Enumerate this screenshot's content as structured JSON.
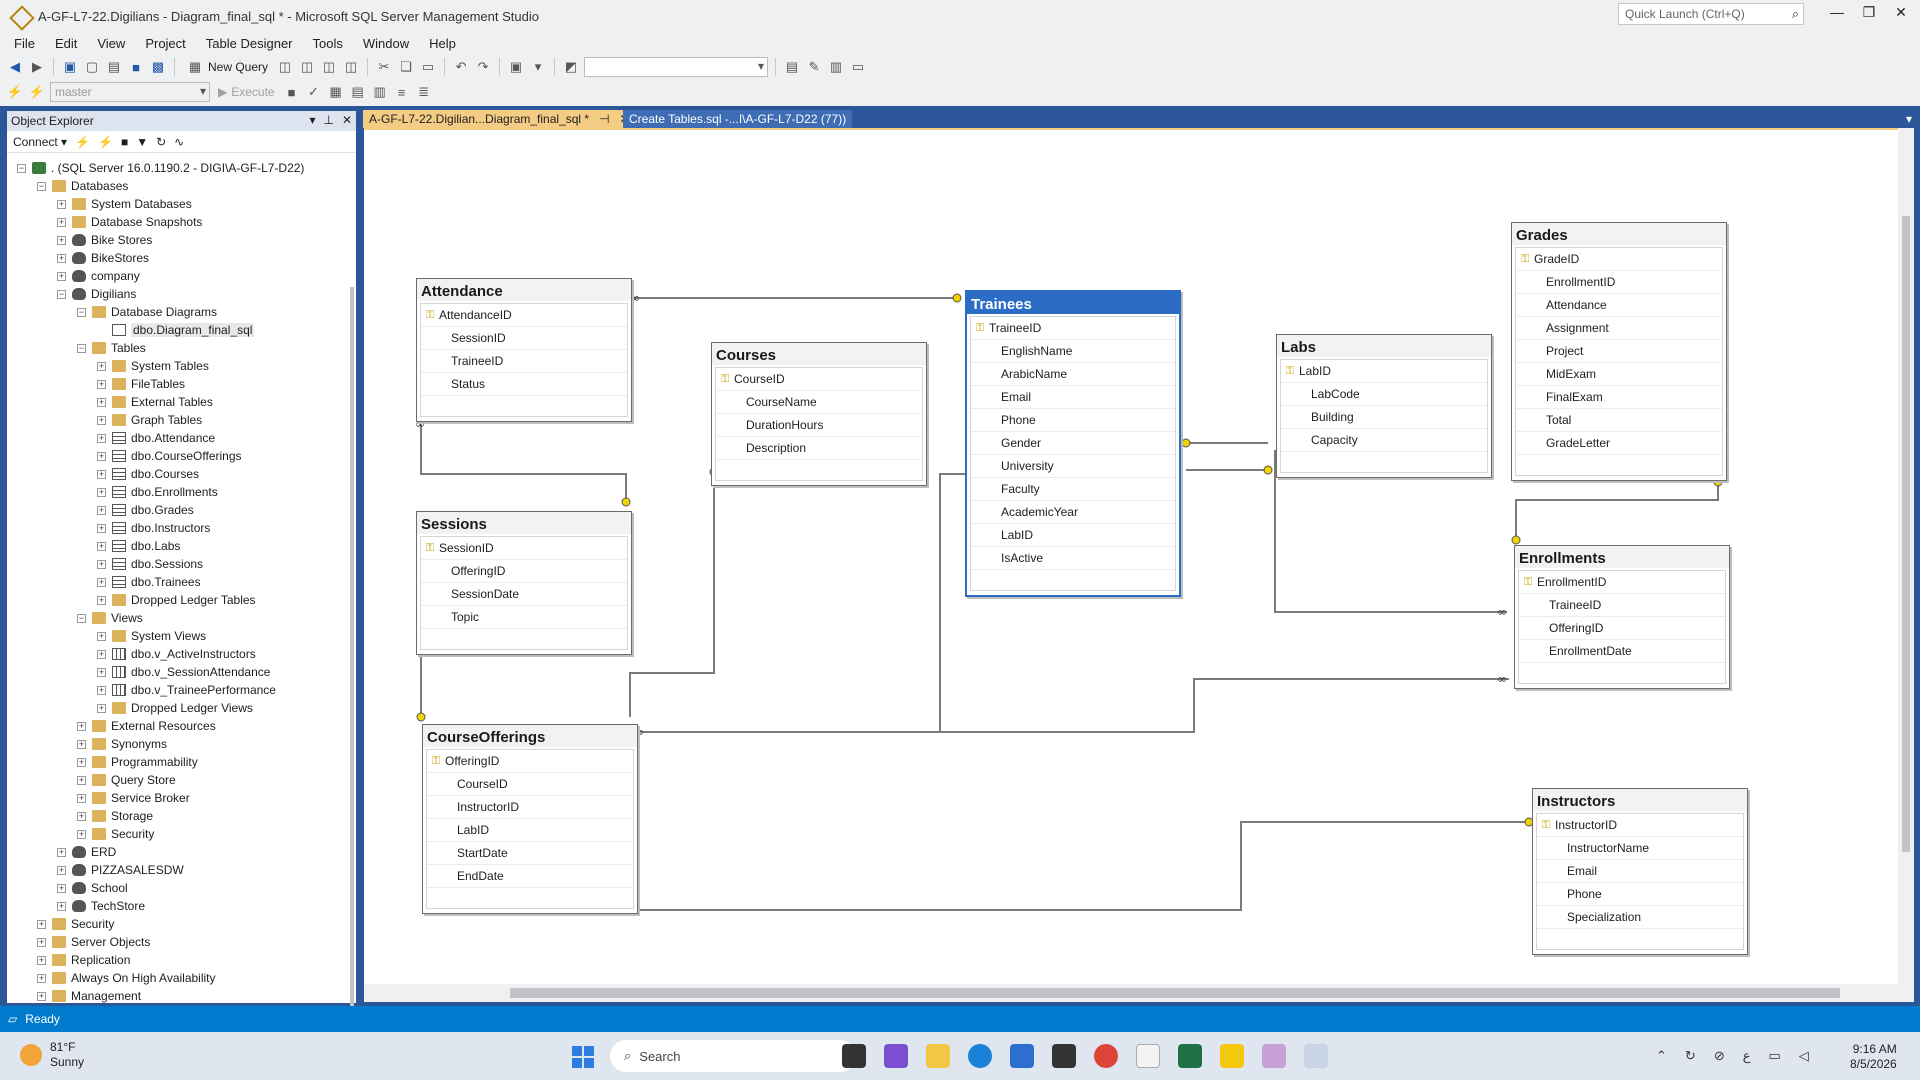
{
  "window": {
    "title": "A-GF-L7-22.Digilians - Diagram_final_sql * - Microsoft SQL Server Management Studio",
    "quick_launch_placeholder": "Quick Launch (Ctrl+Q)"
  },
  "menu": [
    "File",
    "Edit",
    "View",
    "Project",
    "Table Designer",
    "Tools",
    "Window",
    "Help"
  ],
  "toolbar": {
    "new_query": "New Query",
    "database": "master",
    "execute": "Execute"
  },
  "object_explorer": {
    "title": "Object Explorer",
    "connect": "Connect",
    "tree": [
      {
        "label": ". (SQL Server 16.0.1190.2 - DIGI\\A-GF-L7-D22)",
        "level": 0,
        "exp": "−",
        "icon": "server-icon"
      },
      {
        "label": "Databases",
        "level": 1,
        "exp": "−",
        "icon": "folder-icon"
      },
      {
        "label": "System Databases",
        "level": 2,
        "exp": "+",
        "icon": "folder-icon"
      },
      {
        "label": "Database Snapshots",
        "level": 2,
        "exp": "+",
        "icon": "folder-icon"
      },
      {
        "label": "Bike Stores",
        "level": 2,
        "exp": "+",
        "icon": "database-icon"
      },
      {
        "label": "BikeStores",
        "level": 2,
        "exp": "+",
        "icon": "database-icon"
      },
      {
        "label": "company",
        "level": 2,
        "exp": "+",
        "icon": "database-icon"
      },
      {
        "label": "Digilians",
        "level": 2,
        "exp": "−",
        "icon": "database-icon"
      },
      {
        "label": "Database Diagrams",
        "level": 3,
        "exp": "−",
        "icon": "folder-icon"
      },
      {
        "label": "dbo.Diagram_final_sql",
        "level": 4,
        "exp": "",
        "icon": "diagram-icon",
        "selected": true
      },
      {
        "label": "Tables",
        "level": 3,
        "exp": "−",
        "icon": "folder-icon"
      },
      {
        "label": "System Tables",
        "level": 4,
        "exp": "+",
        "icon": "folder-icon"
      },
      {
        "label": "FileTables",
        "level": 4,
        "exp": "+",
        "icon": "folder-icon"
      },
      {
        "label": "External Tables",
        "level": 4,
        "exp": "+",
        "icon": "folder-icon"
      },
      {
        "label": "Graph Tables",
        "level": 4,
        "exp": "+",
        "icon": "folder-icon"
      },
      {
        "label": "dbo.Attendance",
        "level": 4,
        "exp": "+",
        "icon": "table-icon"
      },
      {
        "label": "dbo.CourseOfferings",
        "level": 4,
        "exp": "+",
        "icon": "table-icon"
      },
      {
        "label": "dbo.Courses",
        "level": 4,
        "exp": "+",
        "icon": "table-icon"
      },
      {
        "label": "dbo.Enrollments",
        "level": 4,
        "exp": "+",
        "icon": "table-icon"
      },
      {
        "label": "dbo.Grades",
        "level": 4,
        "exp": "+",
        "icon": "table-icon"
      },
      {
        "label": "dbo.Instructors",
        "level": 4,
        "exp": "+",
        "icon": "table-icon"
      },
      {
        "label": "dbo.Labs",
        "level": 4,
        "exp": "+",
        "icon": "table-icon"
      },
      {
        "label": "dbo.Sessions",
        "level": 4,
        "exp": "+",
        "icon": "table-icon"
      },
      {
        "label": "dbo.Trainees",
        "level": 4,
        "exp": "+",
        "icon": "table-icon"
      },
      {
        "label": "Dropped Ledger Tables",
        "level": 4,
        "exp": "+",
        "icon": "folder-icon"
      },
      {
        "label": "Views",
        "level": 3,
        "exp": "−",
        "icon": "folder-icon"
      },
      {
        "label": "System Views",
        "level": 4,
        "exp": "+",
        "icon": "folder-icon"
      },
      {
        "label": "dbo.v_ActiveInstructors",
        "level": 4,
        "exp": "+",
        "icon": "view-icon"
      },
      {
        "label": "dbo.v_SessionAttendance",
        "level": 4,
        "exp": "+",
        "icon": "view-icon"
      },
      {
        "label": "dbo.v_TraineePerformance",
        "level": 4,
        "exp": "+",
        "icon": "view-icon"
      },
      {
        "label": "Dropped Ledger Views",
        "level": 4,
        "exp": "+",
        "icon": "folder-icon"
      },
      {
        "label": "External Resources",
        "level": 3,
        "exp": "+",
        "icon": "folder-icon"
      },
      {
        "label": "Synonyms",
        "level": 3,
        "exp": "+",
        "icon": "folder-icon"
      },
      {
        "label": "Programmability",
        "level": 3,
        "exp": "+",
        "icon": "folder-icon"
      },
      {
        "label": "Query Store",
        "level": 3,
        "exp": "+",
        "icon": "folder-icon"
      },
      {
        "label": "Service Broker",
        "level": 3,
        "exp": "+",
        "icon": "folder-icon"
      },
      {
        "label": "Storage",
        "level": 3,
        "exp": "+",
        "icon": "folder-icon"
      },
      {
        "label": "Security",
        "level": 3,
        "exp": "+",
        "icon": "folder-icon"
      },
      {
        "label": "ERD",
        "level": 2,
        "exp": "+",
        "icon": "database-icon"
      },
      {
        "label": "PIZZASALESDW",
        "level": 2,
        "exp": "+",
        "icon": "database-icon"
      },
      {
        "label": "School",
        "level": 2,
        "exp": "+",
        "icon": "database-icon"
      },
      {
        "label": "TechStore",
        "level": 2,
        "exp": "+",
        "icon": "database-icon"
      },
      {
        "label": "Security",
        "level": 1,
        "exp": "+",
        "icon": "folder-icon"
      },
      {
        "label": "Server Objects",
        "level": 1,
        "exp": "+",
        "icon": "folder-icon"
      },
      {
        "label": "Replication",
        "level": 1,
        "exp": "+",
        "icon": "folder-icon"
      },
      {
        "label": "Always On High Availability",
        "level": 1,
        "exp": "+",
        "icon": "folder-icon"
      },
      {
        "label": "Management",
        "level": 1,
        "exp": "+",
        "icon": "folder-icon"
      }
    ]
  },
  "tabs": [
    {
      "label": "A-GF-L7-22.Digilian...Diagram_final_sql *",
      "active": true
    },
    {
      "label": "Create Tables.sql -...I\\A-GF-L7-D22 (77))",
      "active": false
    }
  ],
  "diagram": {
    "tables": [
      {
        "name": "Attendance",
        "columns": [
          "AttendanceID",
          "SessionID",
          "TraineeID",
          "Status"
        ],
        "pk": [
          0
        ]
      },
      {
        "name": "Courses",
        "columns": [
          "CourseID",
          "CourseName",
          "DurationHours",
          "Description"
        ],
        "pk": [
          0
        ]
      },
      {
        "name": "Trainees",
        "columns": [
          "TraineeID",
          "EnglishName",
          "ArabicName",
          "Email",
          "Phone",
          "Gender",
          "University",
          "Faculty",
          "AcademicYear",
          "LabID",
          "IsActive"
        ],
        "pk": [
          0
        ],
        "selected": true
      },
      {
        "name": "Labs",
        "columns": [
          "LabID",
          "LabCode",
          "Building",
          "Capacity"
        ],
        "pk": [
          0
        ]
      },
      {
        "name": "Grades",
        "columns": [
          "GradeID",
          "EnrollmentID",
          "Attendance",
          "Assignment",
          "Project",
          "MidExam",
          "FinalExam",
          "Total",
          "GradeLetter"
        ],
        "pk": [
          0
        ]
      },
      {
        "name": "Sessions",
        "columns": [
          "SessionID",
          "OfferingID",
          "SessionDate",
          "Topic"
        ],
        "pk": [
          0
        ]
      },
      {
        "name": "Enrollments",
        "columns": [
          "EnrollmentID",
          "TraineeID",
          "OfferingID",
          "EnrollmentDate"
        ],
        "pk": [
          0
        ]
      },
      {
        "name": "CourseOfferings",
        "columns": [
          "OfferingID",
          "CourseID",
          "InstructorID",
          "LabID",
          "StartDate",
          "EndDate"
        ],
        "pk": [
          0
        ]
      },
      {
        "name": "Instructors",
        "columns": [
          "InstructorID",
          "InstructorName",
          "Email",
          "Phone",
          "Specialization"
        ],
        "pk": [
          0
        ]
      }
    ]
  },
  "status": {
    "text": "Ready"
  },
  "taskbar": {
    "temperature": "81°F",
    "weather": "Sunny",
    "search": "Search",
    "time": "9:16 AM",
    "date": "8/5/2026"
  },
  "colors": {
    "accent": "#2b579a",
    "tab_active": "#f5cc84",
    "status_bar": "#007acc",
    "selection": "#2b6cc4"
  }
}
